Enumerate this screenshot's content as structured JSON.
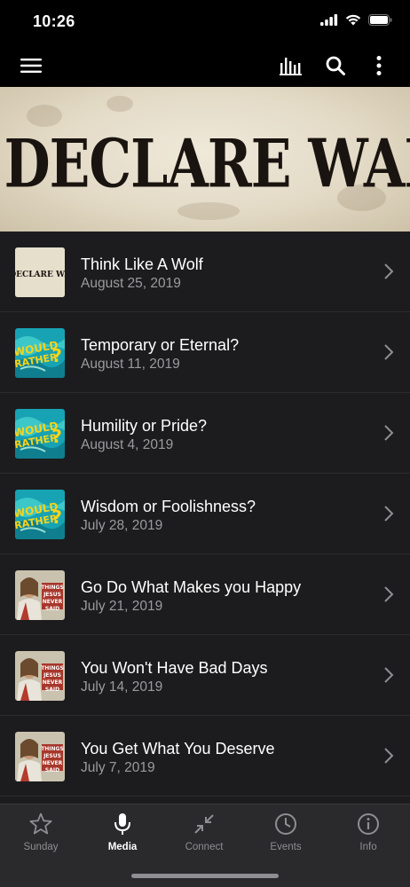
{
  "status_bar": {
    "time": "10:26",
    "icons": [
      "cellular-signal-icon",
      "wifi-icon",
      "battery-icon"
    ]
  },
  "app_bar": {
    "icons": [
      "hamburger-menu-icon",
      "audio-bars-icon",
      "search-icon",
      "more-vertical-icon"
    ]
  },
  "banner": {
    "title": "I DECLARE WAR"
  },
  "sermons": [
    {
      "title": "Think Like A Wolf",
      "date": "August 25, 2019",
      "series": "I Declare War"
    },
    {
      "title": "Temporary or Eternal?",
      "date": "August 11, 2019",
      "series": "Would You Rather?"
    },
    {
      "title": "Humility or Pride?",
      "date": "August 4, 2019",
      "series": "Would You Rather?"
    },
    {
      "title": "Wisdom or Foolishness?",
      "date": "July 28, 2019",
      "series": "Would You Rather?"
    },
    {
      "title": "Go Do What Makes you Happy",
      "date": "July 21, 2019",
      "series": "Things Jesus Never Said"
    },
    {
      "title": "You Won't Have Bad Days",
      "date": "July 14, 2019",
      "series": "Things Jesus Never Said"
    },
    {
      "title": "You Get What You Deserve",
      "date": "July 7, 2019",
      "series": "Things Jesus Never Said"
    }
  ],
  "tabs": [
    {
      "label": "Sunday",
      "icon": "star-icon",
      "active": false
    },
    {
      "label": "Media",
      "icon": "microphone-icon",
      "active": true
    },
    {
      "label": "Connect",
      "icon": "compress-arrows-icon",
      "active": false
    },
    {
      "label": "Events",
      "icon": "clock-icon",
      "active": false
    },
    {
      "label": "Info",
      "icon": "info-icon",
      "active": false
    }
  ],
  "colors": {
    "background": "#1c1c1e",
    "tab_bar": "#2a2a2c",
    "secondary_text": "#9b9b9f",
    "inactive_tab": "#8e8e93",
    "would_you_rather_teal": "#1aa6b5",
    "would_you_rather_yellow": "#f5d31a"
  }
}
